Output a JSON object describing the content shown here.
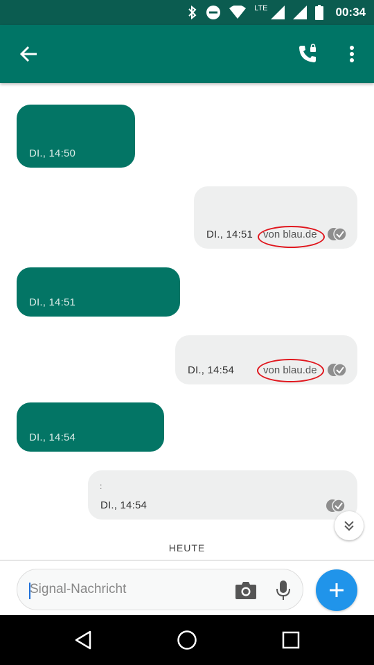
{
  "status_bar": {
    "time": "00:34",
    "network": "LTE",
    "icons": [
      "bluetooth-icon",
      "do-not-disturb-icon",
      "wifi-icon",
      "cell-signal-icon",
      "battery-icon"
    ]
  },
  "app_bar": {
    "icons": [
      "back-arrow-icon",
      "secure-call-icon",
      "overflow-menu-icon"
    ],
    "color": "#007566"
  },
  "messages": [
    {
      "direction": "incoming",
      "timestamp": "DI., 14:50",
      "carrier": "",
      "status": ""
    },
    {
      "direction": "outgoing",
      "timestamp": "DI., 14:51",
      "carrier": "von blau.de",
      "status": "delivered-icon"
    },
    {
      "direction": "incoming",
      "timestamp": "DI., 14:51",
      "carrier": "",
      "status": ""
    },
    {
      "direction": "outgoing",
      "timestamp": "DI., 14:54",
      "carrier": "von blau.de",
      "status": "delivered-icon"
    },
    {
      "direction": "incoming",
      "timestamp": "DI., 14:54",
      "carrier": "",
      "status": ""
    },
    {
      "direction": "outgoing",
      "timestamp": "DI., 14:54",
      "carrier": "",
      "status": "delivered-icon",
      "text": ":"
    }
  ],
  "divider": {
    "label": "HEUTE"
  },
  "composer": {
    "placeholder": "Signal-Nachricht",
    "value": "",
    "icons": [
      "camera-icon",
      "microphone-icon",
      "plus-icon"
    ],
    "send_color": "#2094ea"
  },
  "nav_bar": {
    "icons": [
      "back-triangle-icon",
      "home-circle-icon",
      "recents-square-icon"
    ]
  },
  "colors": {
    "incoming_bubble": "#037565",
    "outgoing_bubble": "#eeefef",
    "highlight_circle": "#e0161d"
  }
}
